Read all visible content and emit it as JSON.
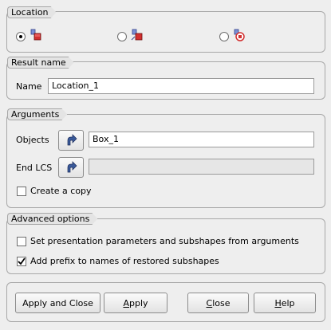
{
  "location_group": {
    "title": "Location",
    "options": [
      {
        "icon": "shape-location-icon",
        "selected": true
      },
      {
        "icon": "shape-location-path-icon",
        "selected": false
      },
      {
        "icon": "shape-location-circle-icon",
        "selected": false
      }
    ]
  },
  "result_group": {
    "title": "Result name",
    "name_label": "Name",
    "name_value": "Location_1"
  },
  "arguments_group": {
    "title": "Arguments",
    "objects_label": "Objects",
    "objects_value": "Box_1",
    "end_lcs_label": "End LCS",
    "end_lcs_value": "",
    "create_copy_label": "Create a copy",
    "create_copy_checked": false
  },
  "advanced_group": {
    "title": "Advanced options",
    "set_params_label": "Set presentation parameters and subshapes from arguments",
    "set_params_checked": false,
    "add_prefix_label": "Add prefix to names of restored subshapes",
    "add_prefix_checked": true
  },
  "buttons": {
    "apply_close": "Apply and Close",
    "apply_first": "A",
    "apply_rest": "pply",
    "close_first": "C",
    "close_rest": "lose",
    "help_first": "H",
    "help_rest": "elp"
  }
}
